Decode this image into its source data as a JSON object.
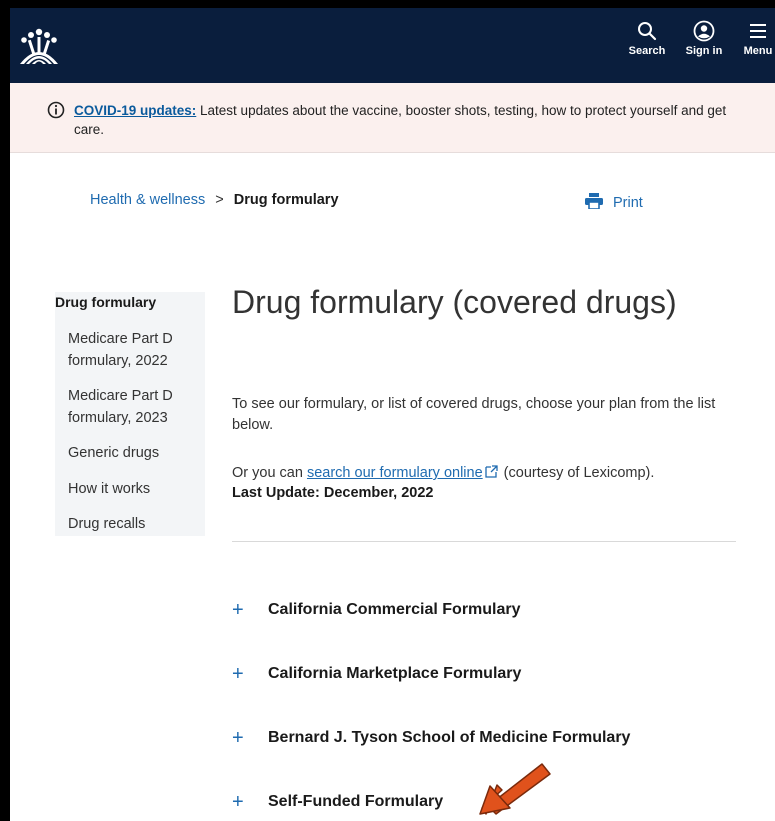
{
  "header": {
    "nav": {
      "search_label": "Search",
      "signin_label": "Sign in",
      "menu_label": "Menu"
    }
  },
  "banner": {
    "link_text": "COVID-19 updates:",
    "text": " Latest updates about the vaccine, booster shots, testing, how to protect yourself and get care."
  },
  "breadcrumb": {
    "parent": "Health & wellness",
    "separator": ">",
    "current": "Drug formulary"
  },
  "print_label": "Print",
  "sidebar": {
    "heading": "Drug formulary",
    "items": [
      "Medicare Part D formulary, 2022",
      "Medicare Part D formulary, 2023",
      "Generic drugs",
      "How it works",
      "Drug recalls"
    ]
  },
  "main": {
    "title": "Drug formulary (covered drugs)",
    "intro": "To see our formulary, or list of covered drugs, choose your plan from the list below.",
    "lexi_prefix": "Or you can ",
    "lexi_link": "search our formulary online",
    "lexi_suffix": " (courtesy of Lexicomp).",
    "last_update": "Last Update: December, 2022",
    "accordion": [
      "California Commercial Formulary",
      "California Marketplace Formulary",
      "Bernard J. Tyson School of Medicine Formulary",
      "Self-Funded Formulary"
    ],
    "accordion_symbol": "+"
  },
  "colors": {
    "header_bg": "#0a1e3d",
    "banner_bg": "#fbf0ee",
    "link": "#1f6bb0",
    "arrow": "#e0521c"
  }
}
